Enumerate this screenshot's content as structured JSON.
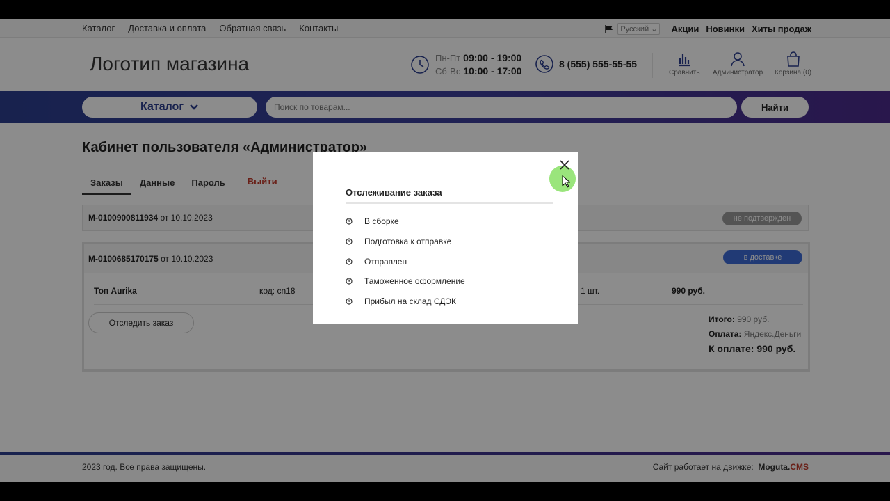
{
  "topnav": [
    "Каталог",
    "Доставка и оплата",
    "Обратная связь",
    "Контакты"
  ],
  "lang": "Русский",
  "toplinks": [
    "Акции",
    "Новинки",
    "Хиты продаж"
  ],
  "header": {
    "logo": "Логотип магазина",
    "hours": [
      {
        "days": "Пн-Пт",
        "time": "09:00 - 19:00"
      },
      {
        "days": "Сб-Вс",
        "time": "10:00 - 17:00"
      }
    ],
    "phone": "8 (555) 555-55-55",
    "compare_label": "Сравнить",
    "user_label": "Администратор",
    "cart_label": "Корзина (0)"
  },
  "search": {
    "catalog_label": "Каталог",
    "placeholder": "Поиск по товарам...",
    "find_label": "Найти"
  },
  "page": {
    "title": "Кабинет пользователя «Администратор»",
    "tabs": [
      "Заказы",
      "Данные",
      "Пароль"
    ],
    "logout": "Выйти"
  },
  "orders": [
    {
      "number": "M-0100900811934",
      "date": "от 10.10.2023",
      "status": "не подтвержден"
    },
    {
      "number": "M-0100685170175",
      "date": "от 10.10.2023",
      "status": "в доставке",
      "item": {
        "name": "Топ Aurika",
        "code": "код: cn18",
        "qty": "1 шт.",
        "price": "990 руб."
      },
      "track_label": "Отследить заказ",
      "total_label": "Итого:",
      "total_value": "990 руб.",
      "payment_label": "Оплата:",
      "payment_value": "Яндекс.Деньги",
      "due": "К оплате: 990 руб."
    }
  ],
  "footer": {
    "copyright": "2023 год. Все права защищены.",
    "engine_label": "Сайт работает на движке:",
    "engine_name": "Moguta.",
    "engine_cms": "CMS"
  },
  "modal": {
    "title": "Отслеживание заказа",
    "steps": [
      "В сборке",
      "Подготовка к отправке",
      "Отправлен",
      "Таможенное оформление",
      "Прибыл на склад СДЭК"
    ]
  },
  "colors": {
    "brand": "#2c3f8f",
    "accent": "#c0392b",
    "status_blue": "#3c6bd6",
    "status_grey": "#9a9a9a"
  }
}
